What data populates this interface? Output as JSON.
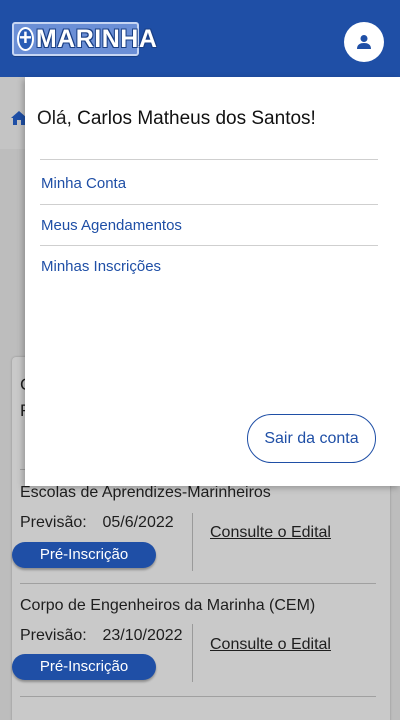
{
  "header": {
    "logo_text": "MARINHA",
    "logo_symbol": "+",
    "brand_color": "#1f4fa6"
  },
  "icons": {
    "user": "user-icon",
    "home": "home-icon",
    "plus": "plus-icon"
  },
  "background": {
    "card_fragments": [
      "C",
      "F"
    ],
    "courses": [
      {
        "title": "Escolas de Aprendizes-Marinheiros",
        "prevision_label": "Previsão:",
        "prevision_date": "05/6/2022",
        "pre_button": "Pré-Inscrição",
        "edital_link": "Consulte o Edital"
      },
      {
        "title": "Corpo de Engenheiros da Marinha (CEM)",
        "prevision_label": "Previsão:",
        "prevision_date": "23/10/2022",
        "pre_button": "Pré-Inscrição",
        "edital_link": "Consulte o Edital"
      }
    ]
  },
  "menu": {
    "greeting_prefix": "Olá,",
    "user_name": "Carlos Matheus dos Santos!",
    "items": [
      {
        "label": "Minha Conta"
      },
      {
        "label": "Meus Agendamentos"
      },
      {
        "label": "Minhas Inscrições"
      }
    ],
    "logout_label": "Sair da conta"
  }
}
